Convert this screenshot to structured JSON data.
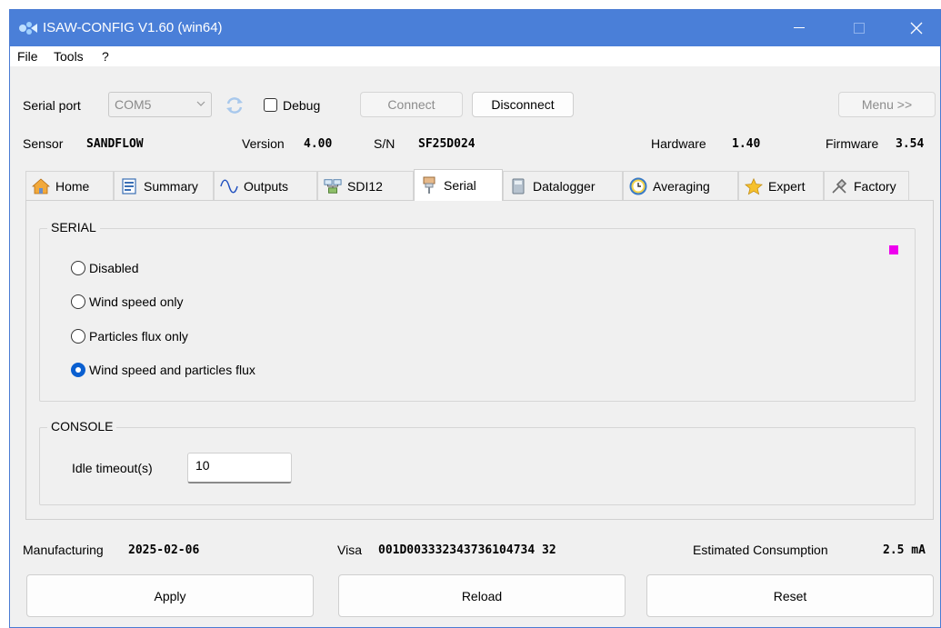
{
  "window": {
    "title": "ISAW-CONFIG V1.60 (win64)"
  },
  "menu": [
    "File",
    "Tools",
    "?"
  ],
  "toolbar": {
    "serial_port_label": "Serial port",
    "serial_port_value": "COM5",
    "debug_label": "Debug",
    "connect_label": "Connect",
    "disconnect_label": "Disconnect",
    "menu_label": "Menu >>"
  },
  "device_info": {
    "sensor_label": "Sensor",
    "sensor_value": "SANDFLOW",
    "version_label": "Version",
    "version_value": "4.00",
    "sn_label": "S/N",
    "sn_value": "SF25D024",
    "hardware_label": "Hardware",
    "hardware_value": "1.40",
    "firmware_label": "Firmware",
    "firmware_value": "3.54"
  },
  "tabs": [
    {
      "label": "Home",
      "icon": "home-icon"
    },
    {
      "label": "Summary",
      "icon": "summary-icon"
    },
    {
      "label": "Outputs",
      "icon": "wave-icon"
    },
    {
      "label": "SDI12",
      "icon": "network-icon"
    },
    {
      "label": "Serial",
      "icon": "serial-connector-icon",
      "active": true
    },
    {
      "label": "Datalogger",
      "icon": "datalogger-icon"
    },
    {
      "label": "Averaging",
      "icon": "clock-icon"
    },
    {
      "label": "Expert",
      "icon": "star-icon"
    },
    {
      "label": "Factory",
      "icon": "tools-icon"
    }
  ],
  "serial_group": {
    "title": "SERIAL",
    "options": [
      "Disabled",
      "Wind speed only",
      "Particles flux only",
      "Wind speed and particles flux"
    ],
    "selected": "Wind speed and particles flux",
    "indicator_color": "#ee00ee"
  },
  "console_group": {
    "title": "CONSOLE",
    "idle_timeout_label": "Idle timeout(s)",
    "idle_timeout_value": "10"
  },
  "footer": {
    "manufacturing_label": "Manufacturing",
    "manufacturing_value": "2025-02-06",
    "visa_label": "Visa",
    "visa_value": "001D003332343736104734 32",
    "consumption_label": "Estimated Consumption",
    "consumption_value": "2.5 mA"
  },
  "actions": {
    "apply": "Apply",
    "reload": "Reload",
    "reset": "Reset"
  },
  "colors": {
    "titlebar": "#4a7fd8",
    "selected_radio": "#0a5fd0"
  }
}
